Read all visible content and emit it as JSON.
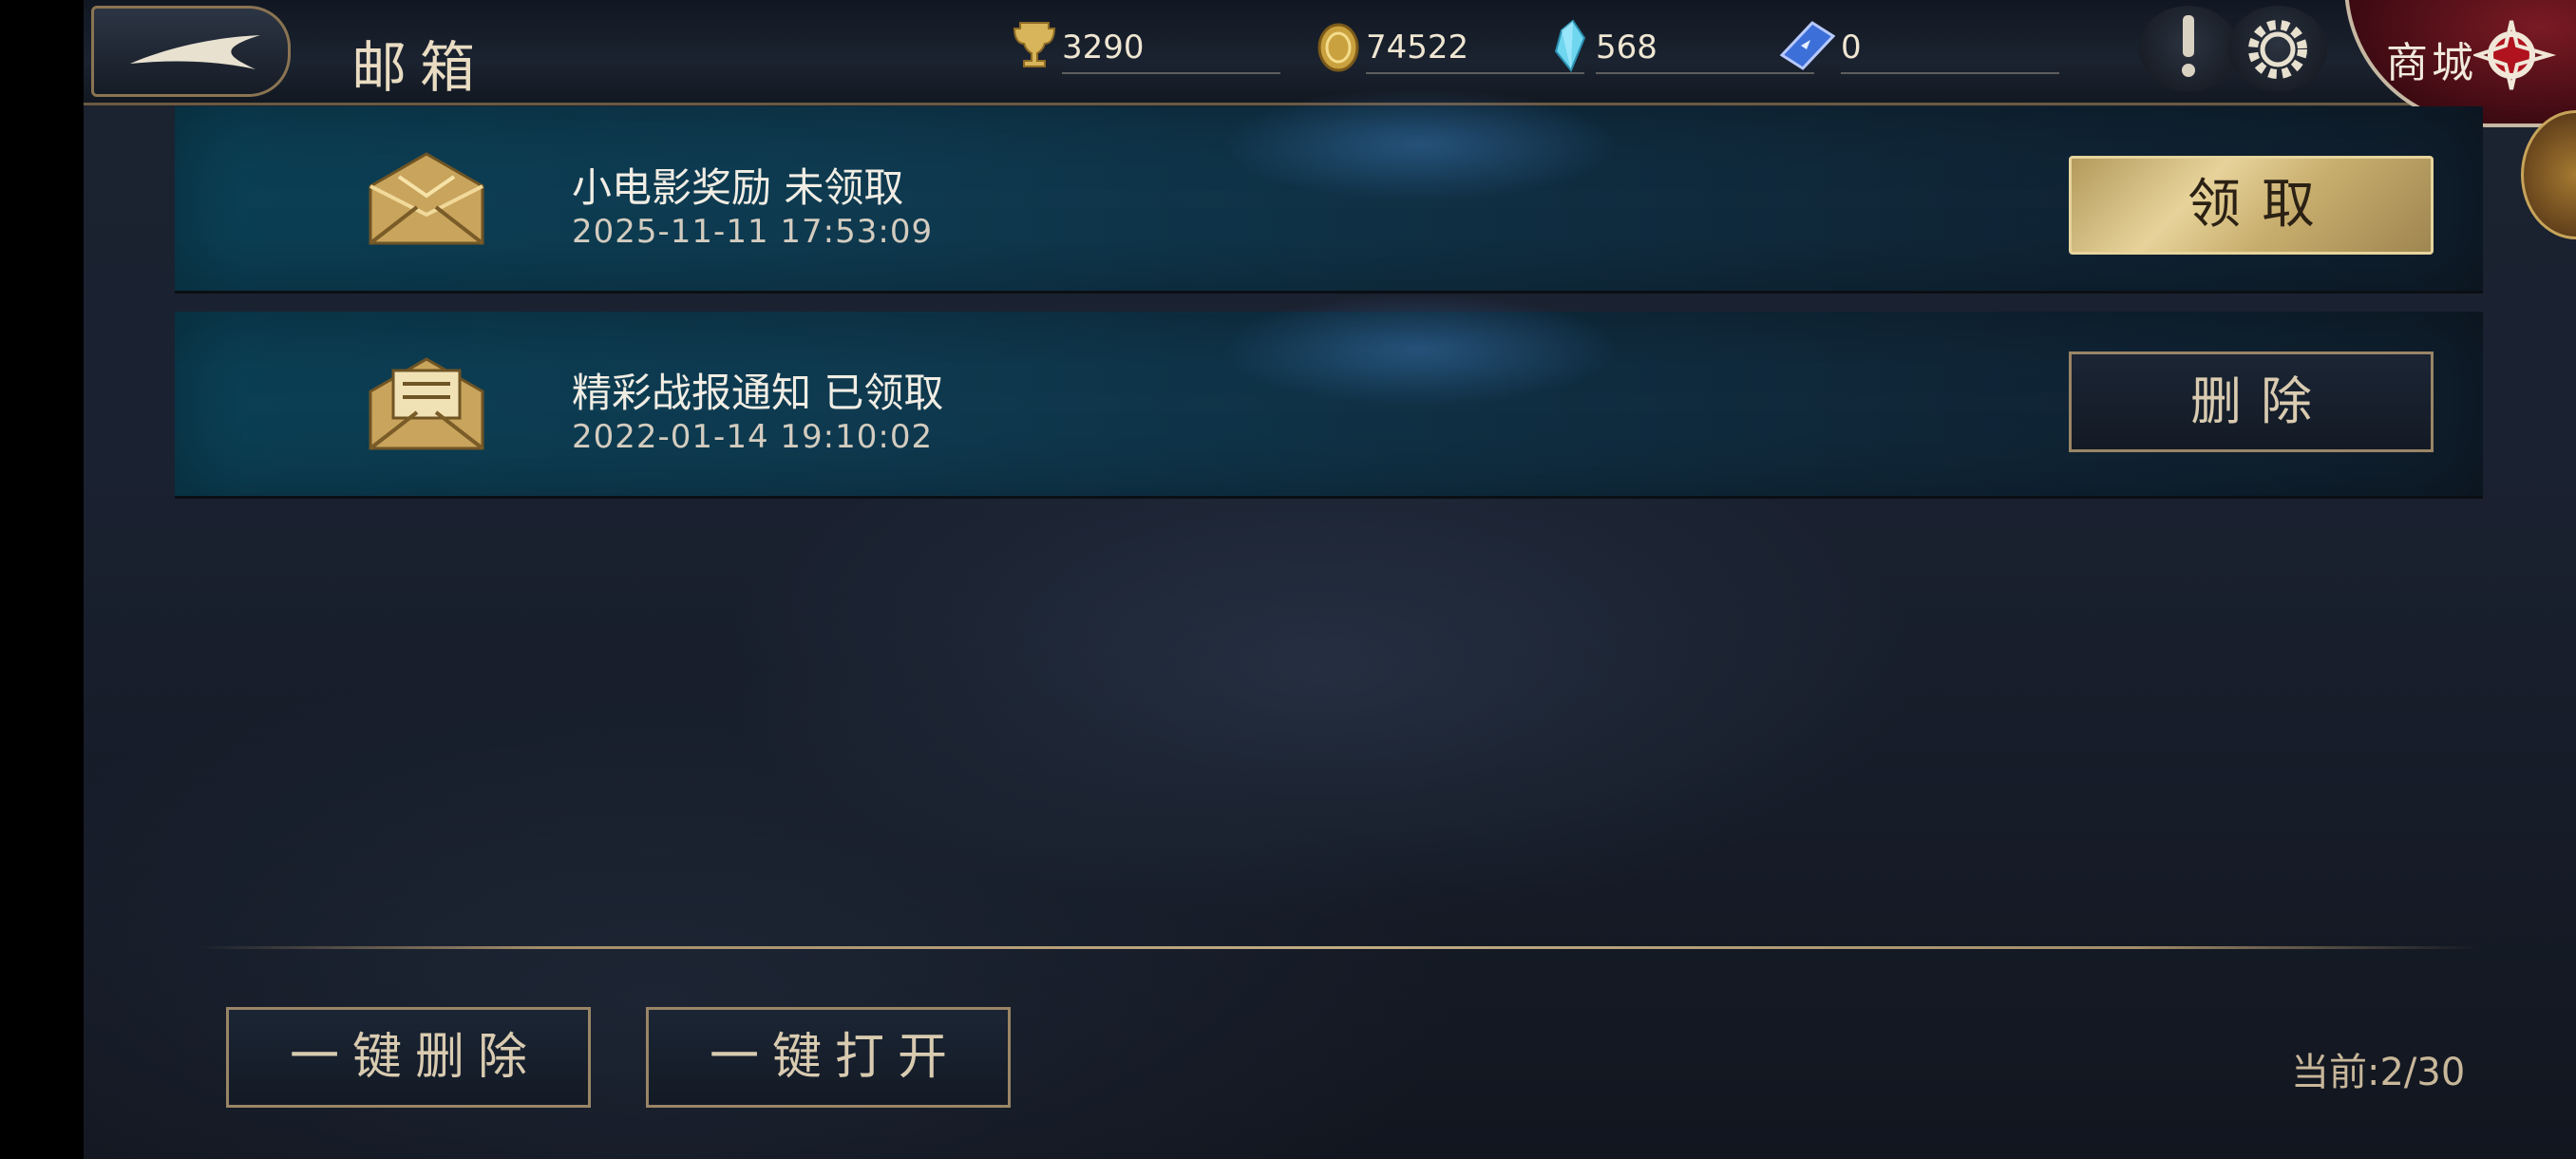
{
  "header": {
    "title": "邮箱",
    "resources": [
      {
        "icon": "trophy-icon",
        "value": "3290"
      },
      {
        "icon": "gold-coin-icon",
        "value": "74522"
      },
      {
        "icon": "crystal-icon",
        "value": "568"
      },
      {
        "icon": "ticket-icon",
        "value": "0"
      }
    ],
    "shop_label": "商城"
  },
  "mails": [
    {
      "title": "小电影奖励 未领取",
      "time": "2025-11-11 17:53:09",
      "icon": "closed-envelope-icon",
      "action": "领取"
    },
    {
      "title": "精彩战报通知 已领取",
      "time": "2022-01-14 19:10:02",
      "icon": "open-letter-icon",
      "action": "删除"
    }
  ],
  "footer": {
    "delete_all": "一键删除",
    "open_all": "一键打开",
    "count": "当前:2/30"
  },
  "colors": {
    "accent_gold": "#e7d39a",
    "row_teal": "#0b3f54",
    "border_bronze": "#9a8566"
  }
}
